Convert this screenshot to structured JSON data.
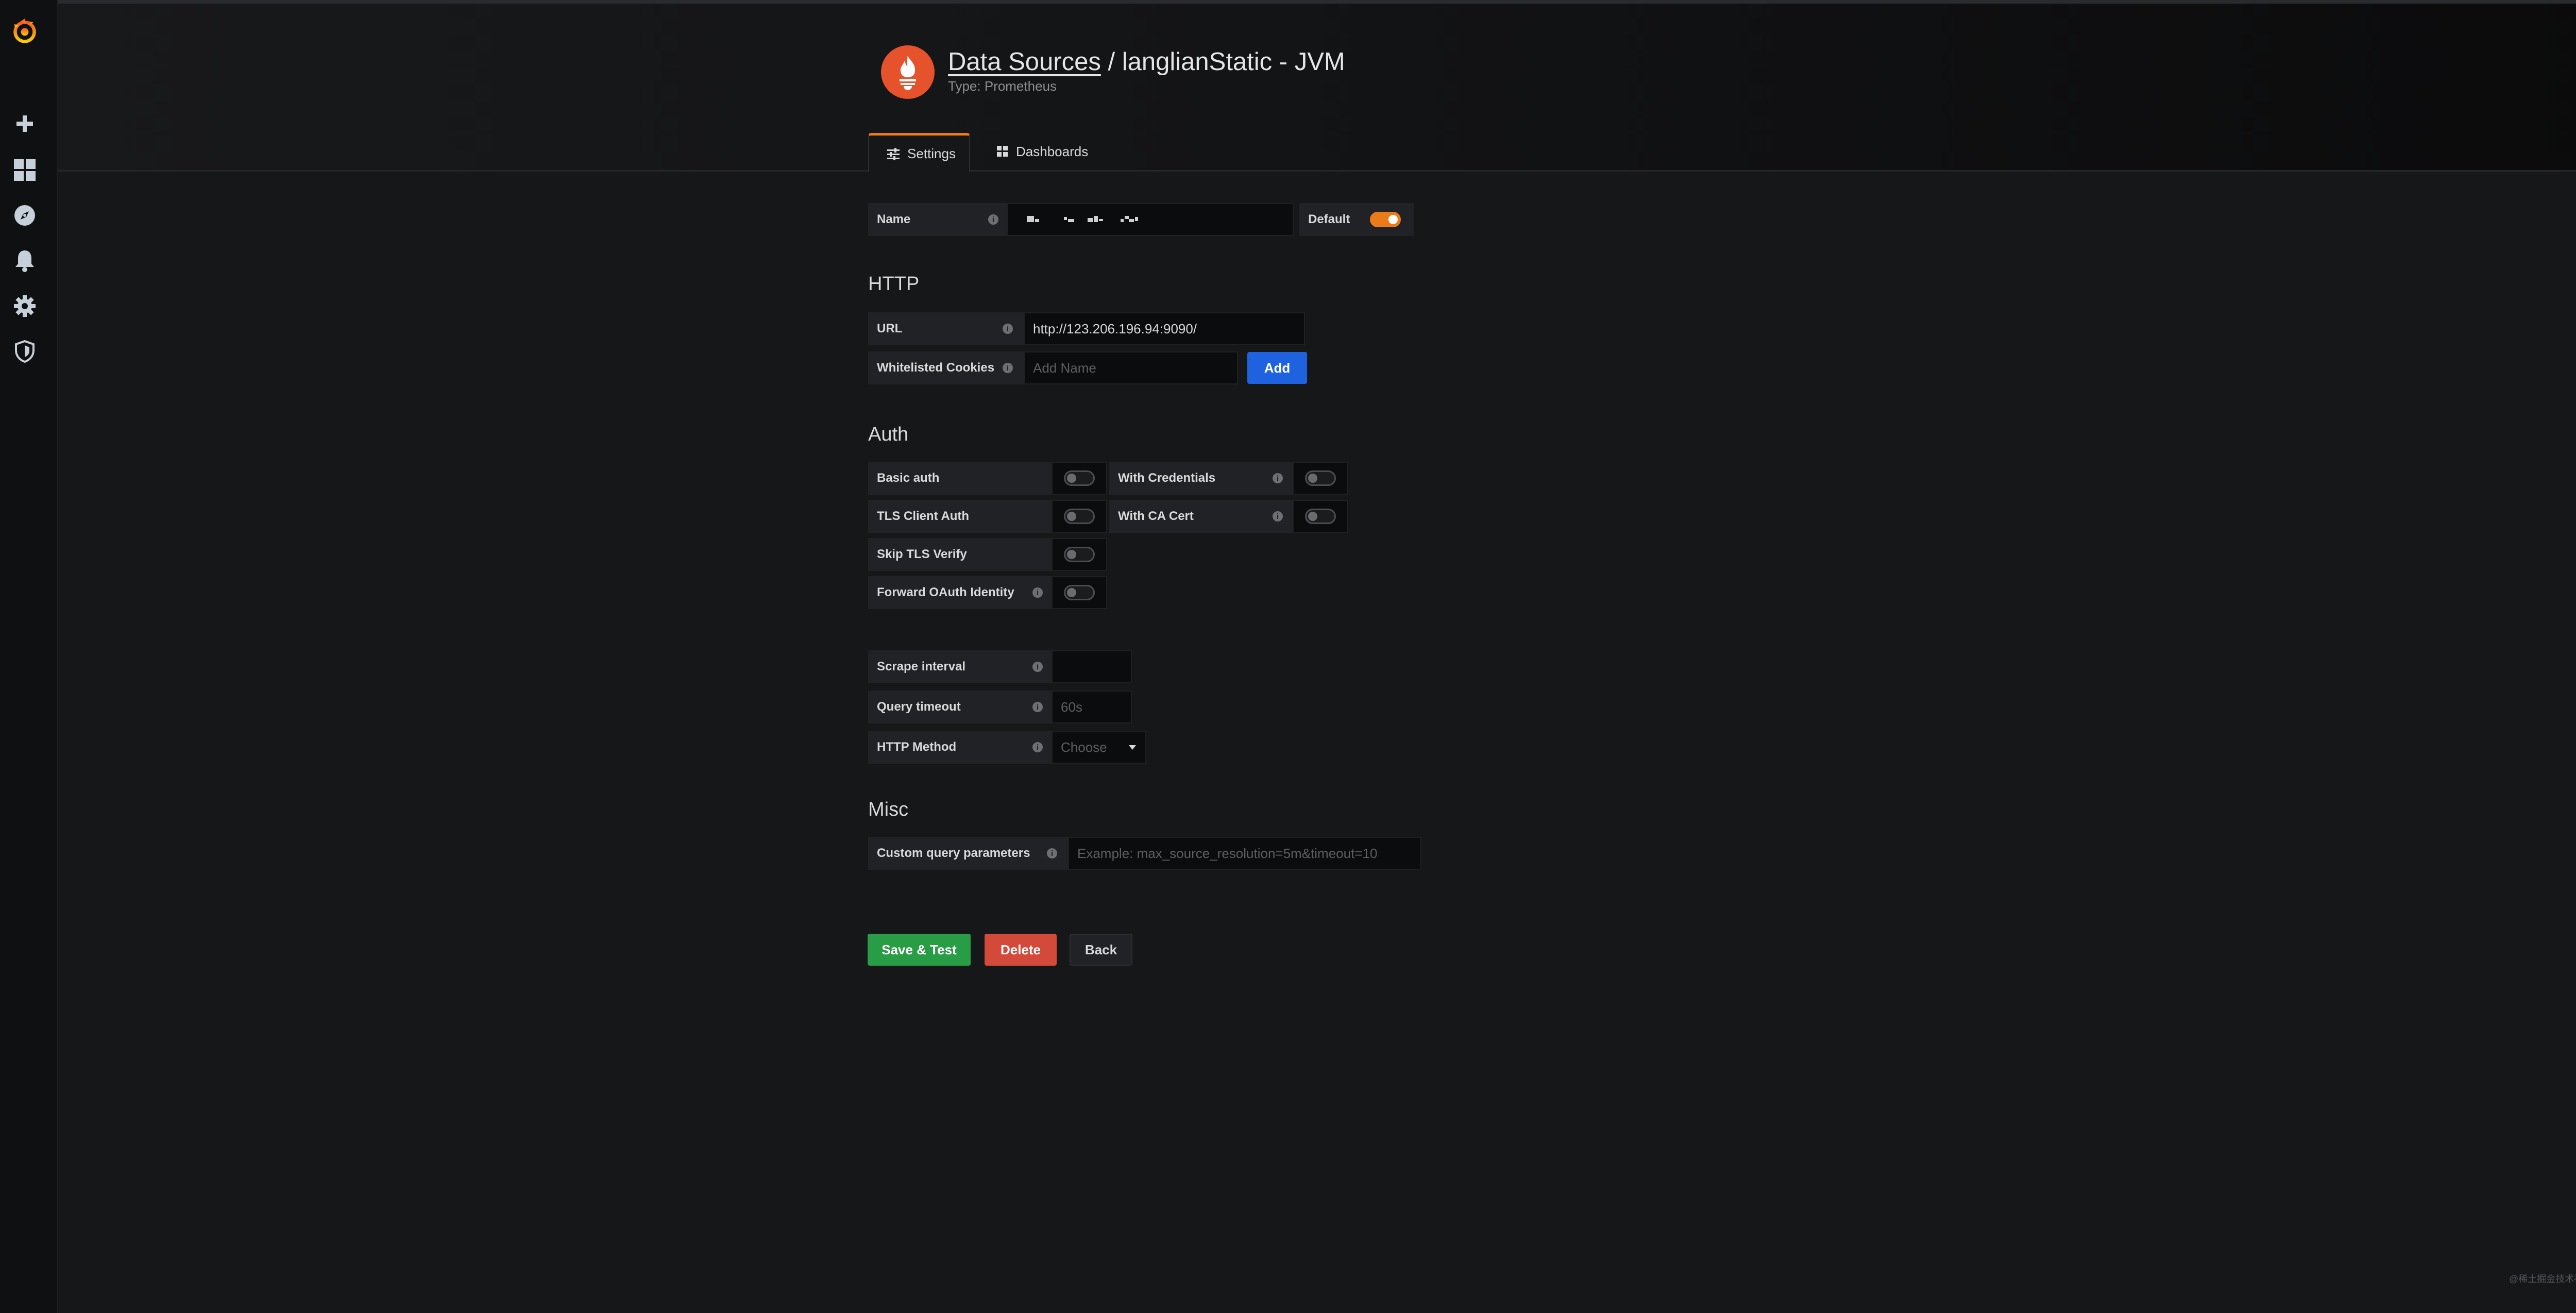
{
  "header": {
    "breadcrumb_link": "Data Sources",
    "breadcrumb_rest": " / langlianStatic - JVM",
    "subtitle": "Type: Prometheus"
  },
  "tabs": [
    {
      "label": "Settings",
      "active": true
    },
    {
      "label": "Dashboards",
      "active": false
    }
  ],
  "name_row": {
    "label": "Name",
    "value": "",
    "default_label": "Default",
    "default_on": true
  },
  "http": {
    "section": "HTTP",
    "url_label": "URL",
    "url_value": "http://123.206.196.94:9090/",
    "cookies_label": "Whitelisted Cookies",
    "cookies_placeholder": "Add Name",
    "add_label": "Add"
  },
  "auth": {
    "section": "Auth",
    "basic_auth": "Basic auth",
    "with_credentials": "With Credentials",
    "tls_client_auth": "TLS Client Auth",
    "with_ca_cert": "With CA Cert",
    "skip_tls_verify": "Skip TLS Verify",
    "forward_oauth": "Forward OAuth Identity"
  },
  "settings": {
    "scrape_label": "Scrape interval",
    "scrape_value": "",
    "timeout_label": "Query timeout",
    "timeout_placeholder": "60s",
    "method_label": "HTTP Method",
    "method_value": "Choose"
  },
  "misc": {
    "section": "Misc",
    "params_label": "Custom query parameters",
    "params_placeholder": "Example: max_source_resolution=5m&timeout=10"
  },
  "buttons": {
    "save": "Save & Test",
    "delete": "Delete",
    "back": "Back"
  },
  "watermark": "@稀土掘金技术社区",
  "colors": {
    "accent": "#eb7b18",
    "save": "#299c46",
    "delete": "#d44a3a",
    "add": "#1f62e0",
    "prometheus": "#e6522c"
  },
  "sidebar_icons": [
    "grafana-logo-icon",
    "plus-icon",
    "dashboards-icon",
    "explore-icon",
    "alerting-bell-icon",
    "configuration-gear-icon",
    "server-admin-shield-icon"
  ]
}
